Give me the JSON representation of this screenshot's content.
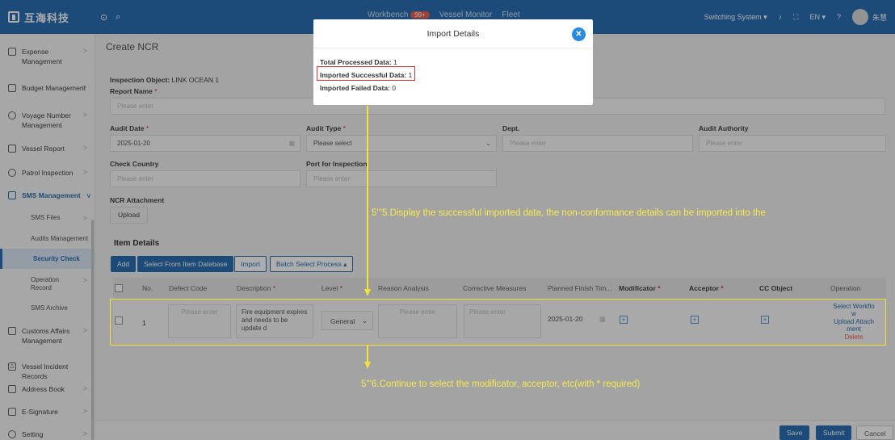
{
  "topbar": {
    "brand": "互海科技",
    "nav_workbench": "Workbench",
    "nav_badge": "99+",
    "nav_vessel_monitor": "Vessel Monitor",
    "nav_fleet": "Fleet",
    "switching_system": "Switching System ▾",
    "language": "EN ▾",
    "user_name": "朱慧"
  },
  "sidebar": {
    "items": [
      {
        "label": "Expense Management"
      },
      {
        "label": "Budget Management"
      },
      {
        "label": "Voyage Number Management"
      },
      {
        "label": "Vessel Report"
      },
      {
        "label": "Patrol Inspection"
      },
      {
        "label": "SMS Management"
      },
      {
        "label": "SMS Files"
      },
      {
        "label": "Audits Management"
      },
      {
        "label": "Security Check"
      },
      {
        "label": "Operation Record"
      },
      {
        "label": "SMS Archive"
      },
      {
        "label": "Customs Affairs Management"
      },
      {
        "label": "Vessel Incident Records"
      },
      {
        "label": "Address Book"
      },
      {
        "label": "E-Signature"
      },
      {
        "label": "Setting"
      }
    ]
  },
  "form": {
    "page_title": "Create NCR",
    "inspection_object_label": "Inspection Object:",
    "inspection_object_value": "LINK OCEAN 1",
    "report_name_label": "Report Name",
    "report_name_placeholder": "Please enter",
    "audit_date_label": "Audit Date",
    "audit_date_value": "2025-01-20",
    "audit_type_label": "Audit Type",
    "audit_type_placeholder": "Please select",
    "dept_label": "Dept.",
    "dept_placeholder": "Please enter",
    "audit_authority_label": "Audit Authority",
    "audit_authority_placeholder": "Please enter",
    "check_country_label": "Check Country",
    "check_country_placeholder": "Please enter",
    "port_label": "Port for Inspection",
    "port_placeholder": "Please enter",
    "attachment_label": "NCR Attachment",
    "upload_label": "Upload",
    "required_mark": "*"
  },
  "items": {
    "section_title": "Item Details",
    "btn_add": "Add",
    "btn_select_db": "Select From Item Datebase",
    "btn_import": "Import",
    "btn_batch": "Batch Select Process ▴",
    "columns": {
      "no": "No.",
      "defect_code": "Defect Code",
      "description": "Description",
      "level": "Level",
      "reason": "Reason Analysis",
      "corrective": "Corrective Measures",
      "planned": "Planned Finish Tim...",
      "modificator": "Modificator",
      "acceptor": "Acceptor",
      "cc": "CC Object",
      "operation": "Operation"
    },
    "rows": [
      {
        "no": "1",
        "defect_code_placeholder": "Please enter",
        "description": "Fire equipment expires and needs to be update d",
        "level": "General",
        "reason_placeholder": "Please enter",
        "corrective_placeholder": "Please enter",
        "planned_date": "2025-01-20",
        "op_select_workflow": "Select Workflo w",
        "op_upload": "Upload Attach ment",
        "op_delete": "Delete"
      }
    ]
  },
  "footer": {
    "save": "Save",
    "submit": "Submit",
    "cancel": "Cancel"
  },
  "modal": {
    "title": "Import Details",
    "total_label": "Total Processed Data:",
    "total_value": "1",
    "success_label": "Imported Successful Data:",
    "success_value": "1",
    "failed_label": "Imported Failed Data:",
    "failed_value": "0"
  },
  "annotations": {
    "step5": "5'''5.Display the successful imported data, the non-conformance details can be imported into the",
    "step6": "5'''6.Continue to select the modificator, acceptor, etc(with * required)"
  },
  "colors": {
    "primary": "#2a6fb3",
    "annotation": "#f2e33b",
    "highlight": "#d33333"
  }
}
